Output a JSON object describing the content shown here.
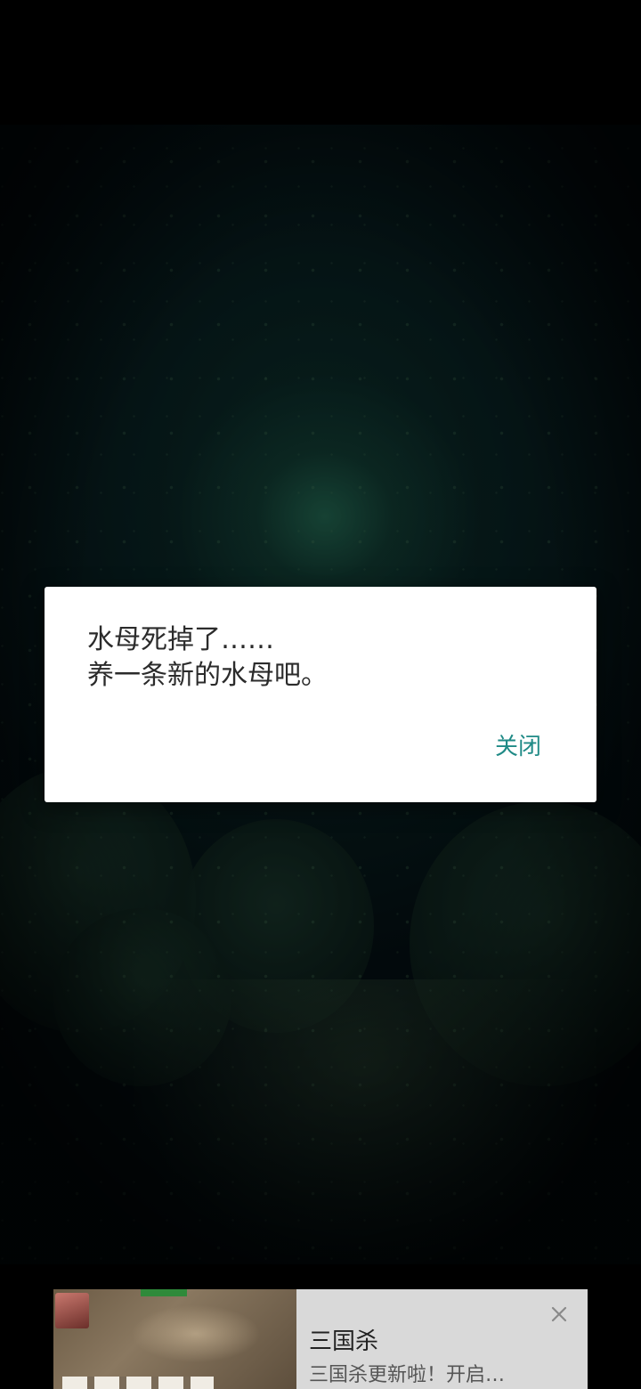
{
  "dialog": {
    "message_line1": "水母死掉了……",
    "message_line2": "养一条新的水母吧。",
    "close_label": "关闭"
  },
  "ad": {
    "title": "三国杀",
    "subtitle": "三国杀更新啦！开启…",
    "close_icon": "close-icon"
  },
  "colors": {
    "accent": "#1f8a86",
    "dialog_bg": "#ffffff",
    "ad_bg": "#d9d9d9"
  }
}
